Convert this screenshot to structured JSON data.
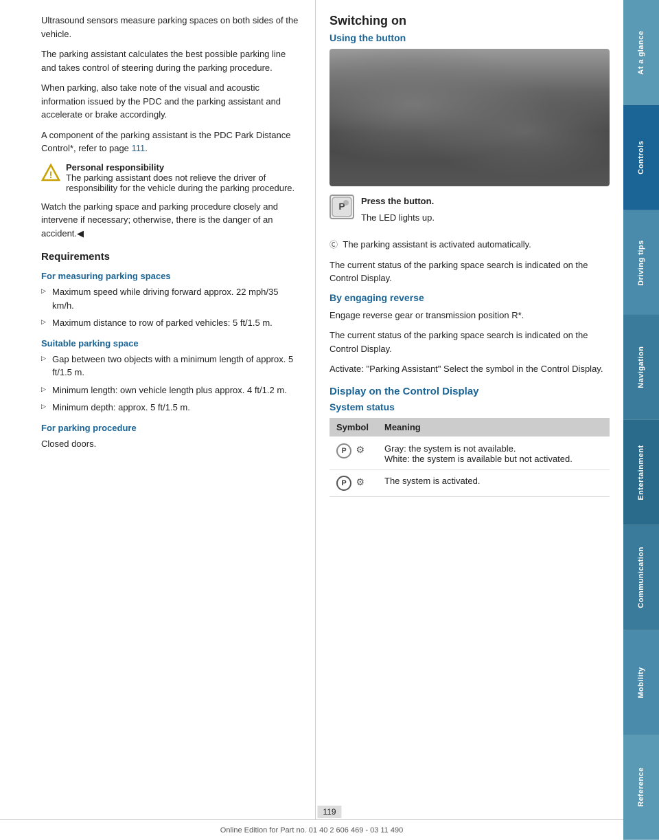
{
  "sidebar": {
    "items": [
      {
        "label": "At a glance",
        "style": "light"
      },
      {
        "label": "Controls",
        "style": "active"
      },
      {
        "label": "Driving tips",
        "style": "medium"
      },
      {
        "label": "Navigation",
        "style": "dark"
      },
      {
        "label": "Entertainment",
        "style": "darker"
      },
      {
        "label": "Communication",
        "style": "dark"
      },
      {
        "label": "Mobility",
        "style": "medium"
      },
      {
        "label": "Reference",
        "style": "light"
      }
    ]
  },
  "left": {
    "intro_p1": "Ultrasound sensors measure parking spaces on both sides of the vehicle.",
    "intro_p2": "The parking assistant calculates the best possible parking line and takes control of steering during the parking procedure.",
    "intro_p3": "When parking, also take note of the visual and acoustic information issued by the PDC and the parking assistant and accelerate or brake accordingly.",
    "intro_p4": "A component of the parking assistant is the PDC Park Distance Control*, refer to page",
    "intro_p4_link": "111",
    "intro_p4_end": ".",
    "warning_title": "Personal responsibility",
    "warning_text": "The parking assistant does not relieve the driver of responsibility for the vehicle during the parking procedure.",
    "warning_p2": "Watch the parking space and parking procedure closely and intervene if necessary; otherwise, there is the danger of an accident.◀",
    "requirements_heading": "Requirements",
    "for_measuring_heading": "For measuring parking spaces",
    "bullet1": "Maximum speed while driving forward approx. 22 mph/35 km/h.",
    "bullet2": "Maximum distance to row of parked vehicles: 5 ft/1.5 m.",
    "suitable_heading": "Suitable parking space",
    "suitable_bullet1": "Gap between two objects with a minimum length of approx. 5 ft/1.5 m.",
    "suitable_bullet2": "Minimum length: own vehicle length plus approx. 4 ft/1.2 m.",
    "suitable_bullet3": "Minimum depth: approx. 5 ft/1.5 m.",
    "for_parking_heading": "For parking procedure",
    "for_parking_text": "Closed doors."
  },
  "right": {
    "switching_on_heading": "Switching on",
    "using_button_heading": "Using the button",
    "press_button": "Press the button.",
    "led_lights": "The LED lights up.",
    "auto_activate": "The parking assistant is activated automatically.",
    "status_text1": "The current status of the parking space search is indicated on the Control Display.",
    "by_engaging_heading": "By engaging reverse",
    "engage_text": "Engage reverse gear or transmission position R*.",
    "status_text2": "The current status of the parking space search is indicated on the Control Display.",
    "activate_text": "Activate:  \"Parking Assistant\" Select the symbol in the Control Display.",
    "display_heading": "Display on the Control Display",
    "system_status_heading": "System status",
    "table": {
      "col_symbol": "Symbol",
      "col_meaning": "Meaning",
      "rows": [
        {
          "symbol": "P⊙",
          "meaning1": "Gray: the system is not available.",
          "meaning2": "White: the system is available but not activated."
        },
        {
          "symbol": "P⊙",
          "meaning1": "The system is activated.",
          "meaning2": ""
        }
      ]
    }
  },
  "footer": {
    "text": "Online Edition for Part no. 01 40 2 606 469 - 03 11 490",
    "page": "119"
  }
}
